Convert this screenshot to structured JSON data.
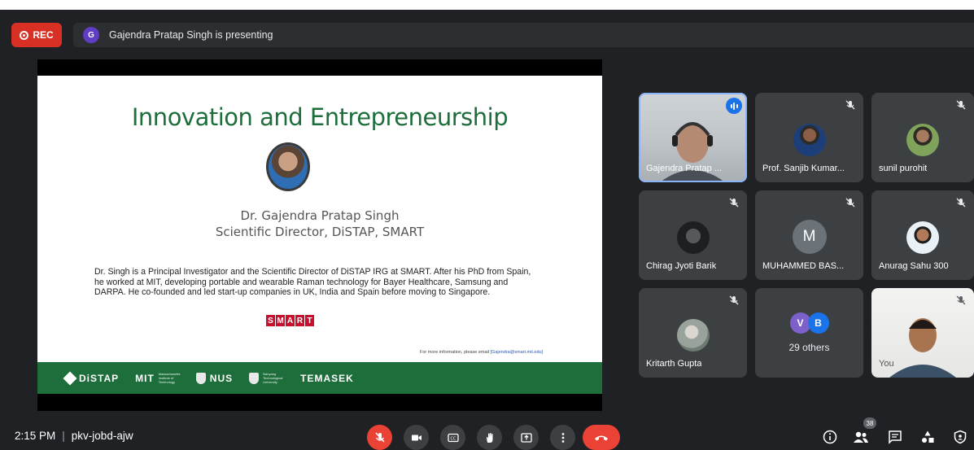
{
  "topbar": {
    "rec_label": "REC",
    "presenter_initial": "G",
    "presenting_text": "Gajendra Pratap Singh is presenting"
  },
  "slide": {
    "title": "Innovation and Entrepreneurship",
    "speaker_name": "Dr. Gajendra Pratap Singh",
    "speaker_role": "Scientific Director, DiSTAP, SMART",
    "bio": "Dr. Singh is a Principal Investigator and the Scientific Director of DiSTAP IRG at SMART. After his PhD from Spain, he worked at MIT, developing portable and wearable Raman technology for Bayer Healthcare, Samsung and DARPA. He co-founded and led start-up companies in UK, India and Spain before moving to Singapore.",
    "smart_logo": [
      "S",
      "M",
      "A",
      "R",
      "T"
    ],
    "contact_prefix": "For more information, please email",
    "contact_email": "[Gajendra@smart.mit.edu]",
    "footer_logos": {
      "distap": "DiSTAP",
      "mit": "MIT",
      "mit_sub": "Massachusetts Institute of Technology",
      "nus": "NUS",
      "ntu_sub": "Nanyang Technological University",
      "temasek": "TEMASEK"
    }
  },
  "participants": [
    {
      "name": "Gajendra Pratap ...",
      "state": "speaking"
    },
    {
      "name": "Prof. Sanjib Kumar...",
      "state": "muted"
    },
    {
      "name": "sunil purohit",
      "state": "muted"
    },
    {
      "name": "Chirag Jyoti Barik",
      "state": "muted"
    },
    {
      "name": "MUHAMMED BAS...",
      "initial": "M",
      "state": "muted"
    },
    {
      "name": "Anurag Sahu 300",
      "state": "muted"
    },
    {
      "name": "Kritarth Gupta",
      "state": "muted"
    },
    {
      "others_label": "29 others",
      "initials": [
        "V",
        "B"
      ]
    },
    {
      "name": "You",
      "state": "muted"
    }
  ],
  "bottombar": {
    "time": "2:15 PM",
    "separator": "|",
    "meeting_code": "pkv-jobd-ajw",
    "people_count": "38"
  },
  "colors": {
    "background": "#202124",
    "tile": "#3c4043",
    "rec_red": "#d93025",
    "accent_blue": "#1a73e8",
    "slide_green": "#1e6e3c",
    "end_call_red": "#ea4335"
  },
  "icons": {
    "controls": [
      "mic-off-icon",
      "camera-icon",
      "captions-icon",
      "raise-hand-icon",
      "present-icon",
      "more-options-icon",
      "end-call-icon"
    ],
    "right": [
      "info-icon",
      "people-icon",
      "chat-icon",
      "activities-icon",
      "host-controls-icon"
    ]
  }
}
